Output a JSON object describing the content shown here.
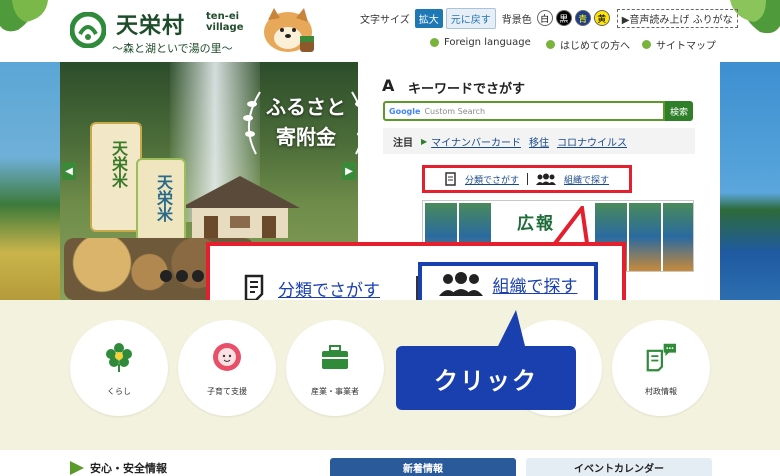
{
  "header": {
    "logo_title": "天栄村",
    "logo_roman": "ten-ei village",
    "logo_tagline": "〜森と湖といで湯の里〜",
    "text_size_label": "文字サイズ",
    "enlarge": "拡大",
    "reset": "元に戻す",
    "bg_color_label": "背景色",
    "color_white": "白",
    "color_black": "黒",
    "color_blue": "青",
    "color_yellow": "黄",
    "read_aloud": "▶音声読み上げ ふりがな",
    "foreign_language": "Foreign language",
    "first_time": "はじめての方へ",
    "sitemap": "サイトマップ"
  },
  "slide": {
    "title_line1": "ふるさと",
    "title_line2": "寄附金",
    "rice_label": "天栄米",
    "rice_label_2": "天栄米"
  },
  "search": {
    "title": "キーワードでさがす",
    "icon": "A",
    "placeholder": "Custom Search",
    "google": "Google",
    "button": "検索"
  },
  "notice": {
    "label": "注目",
    "items": [
      "マイナンバーカード",
      "移住",
      "コロナウイルス"
    ]
  },
  "find": {
    "by_category": "分類でさがす",
    "by_organization": "組織で探す"
  },
  "kouhou": {
    "title": "広報"
  },
  "categories": [
    {
      "label": "くらし",
      "icon": "flower-icon"
    },
    {
      "label": "子育て支援",
      "icon": "baby-icon"
    },
    {
      "label": "産業・事業者",
      "icon": "briefcase-icon"
    },
    {
      "label": "",
      "icon": "hidden"
    },
    {
      "label": "",
      "icon": "hidden"
    },
    {
      "label": "村政情報",
      "icon": "document-chat-icon"
    }
  ],
  "callout": {
    "text": "クリック"
  },
  "bottom": {
    "safety": "安心・安全情報",
    "news_tab": "新着情報",
    "event_tab": "イベントカレンダー"
  },
  "colors": {
    "brand_green": "#2f7f2a",
    "highlight_red": "#e5202e",
    "highlight_blue": "#1a3fae"
  }
}
